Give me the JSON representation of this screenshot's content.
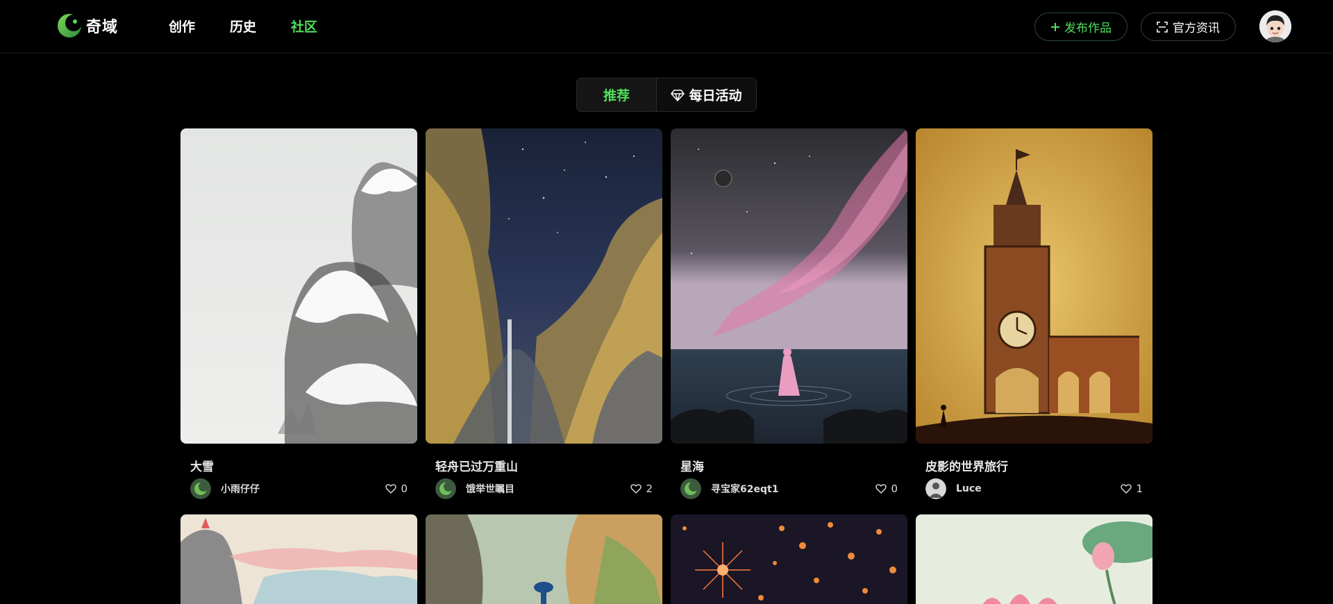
{
  "app": {
    "logo_text": "奇域",
    "logo_icon": "crescent-logo-icon"
  },
  "nav": [
    {
      "label": "创作",
      "active": false
    },
    {
      "label": "历史",
      "active": false
    },
    {
      "label": "社区",
      "active": true
    }
  ],
  "header": {
    "publish_label": "发布作品",
    "news_label": "官方资讯",
    "accent_color": "#4ee05a"
  },
  "tabs": [
    {
      "label": "推荐",
      "active": true
    },
    {
      "label": "每日活动",
      "icon": "diamond-icon",
      "active": false
    }
  ],
  "cards": [
    {
      "title": "大雪",
      "author": "小雨仔仔",
      "likes": "0"
    },
    {
      "title": "轻舟已过万重山",
      "author": "饿举世瞩目",
      "likes": "2"
    },
    {
      "title": "星海",
      "author": "寻宝家62eqt1",
      "likes": "0"
    },
    {
      "title": "皮影的世界旅行",
      "author": "Luce",
      "likes": "1"
    }
  ]
}
